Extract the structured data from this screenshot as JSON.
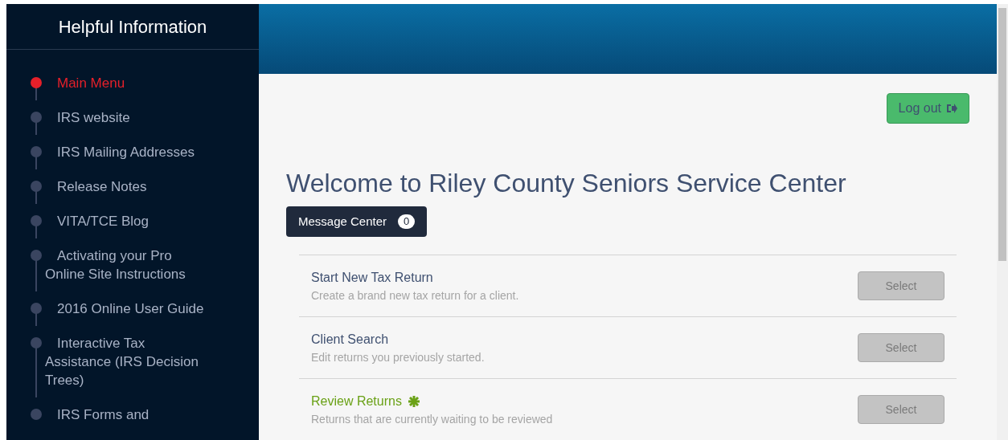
{
  "sidebar": {
    "title": "Helpful Information",
    "items": [
      {
        "label": "Main Menu",
        "selected": true
      },
      {
        "label": "IRS website",
        "selected": false
      },
      {
        "label": "IRS Mailing Addresses",
        "selected": false
      },
      {
        "label": "Release Notes",
        "selected": false
      },
      {
        "label": "VITA/TCE Blog",
        "selected": false
      },
      {
        "label": "Activating your Pro Online Site Instructions",
        "selected": false
      },
      {
        "label": "2016 Online User Guide",
        "selected": false
      },
      {
        "label": "Interactive Tax Assistance (IRS Decision Trees)",
        "selected": false
      },
      {
        "label": "IRS Forms and",
        "selected": false
      }
    ]
  },
  "logout": {
    "label": "Log out"
  },
  "heading": "Welcome to Riley County Seniors Service Center",
  "message_center": {
    "label": "Message Center",
    "count": "0"
  },
  "tasks": [
    {
      "title": "Start New Tax Return",
      "description": "Create a brand new tax return for a client.",
      "button": "Select",
      "highlighted": false
    },
    {
      "title": "Client Search",
      "description": "Edit returns you previously started.",
      "button": "Select",
      "highlighted": false
    },
    {
      "title": "Review Returns",
      "description": "Returns that are currently waiting to be reviewed",
      "button": "Select",
      "highlighted": true
    }
  ]
}
